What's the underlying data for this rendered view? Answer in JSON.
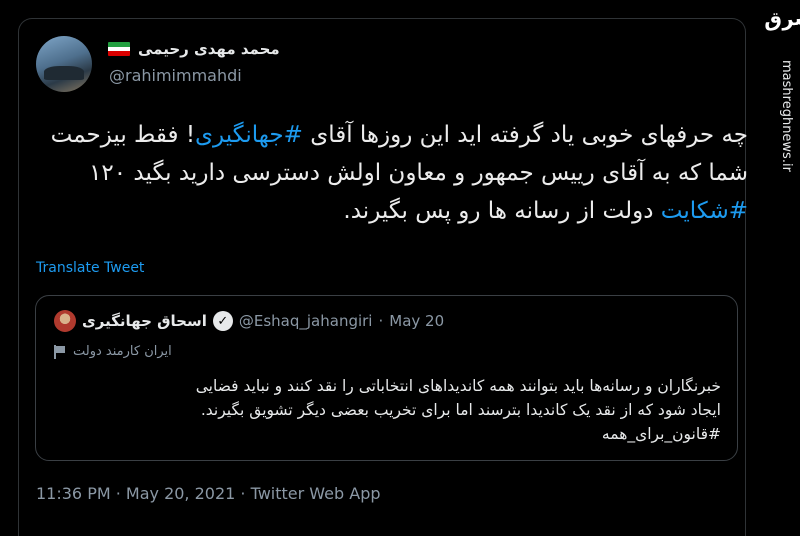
{
  "tweet": {
    "display_name": "محمد مهدی رحیمی",
    "handle": "@rahimimmahdi",
    "text_parts": [
      "چه حرفهای خوبی یاد گرفته اید این روزها آقای ",
      "#جهانگیری",
      "! فقط بیزحمت شما که به آقای رییس جمهور و معاون اولش دسترسی دارید بگید ۱۲۰ ",
      "#شکایت",
      " دولت از رسانه ها رو پس بگیرند."
    ],
    "translate_label": "Translate Tweet",
    "timestamp": "11:36 PM · May 20, 2021 · Twitter Web App"
  },
  "quote": {
    "name": "اسحاق جهانگیری",
    "handle": "@Eshaq_jahangiri",
    "dot": "·",
    "date": "May 20",
    "label": "ایران کارمند دولت",
    "text_lines": [
      "خبرنگاران و رسانه‌ها باید بتوانند همه کاندیداهای انتخاباتی را نقد کنند و نباید فضایی",
      "ایجاد شود که از نقد یک کاندیدا بترسند اما برای تخریب بعضی دیگر تشویق بگیرند.",
      "#قانون_برای_همه"
    ]
  },
  "watermark": {
    "logo": "مشرق",
    "url": "mashreghnews.ir"
  },
  "colors": {
    "background": "#000000",
    "link": "#1d9bf0",
    "muted": "#8b98a5",
    "border": "#2f3336"
  },
  "icons": [
    "iran-flag-icon",
    "verified-icon",
    "government-flag-icon"
  ]
}
